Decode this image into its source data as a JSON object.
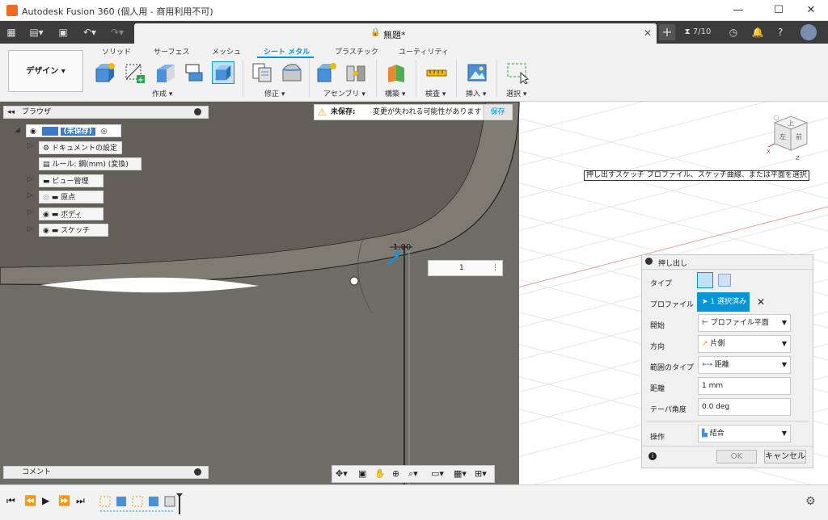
{
  "app": {
    "title": "Autodesk Fusion 360 (個人用 - 商用利用不可)"
  },
  "window_controls": {
    "minimize": "—",
    "maximize": "☐",
    "close": "✕"
  },
  "tabbar": {
    "doc_title": "無題*",
    "close": "✕",
    "new_tab": "+",
    "jobs": "7/10"
  },
  "ribbon": {
    "workspace": "デザイン ▾",
    "tabs": [
      "ソリッド",
      "サーフェス",
      "メッシュ",
      "シート メタル",
      "プラスチック",
      "ユーティリティ"
    ],
    "active_tab": "シート メタル",
    "groups": [
      "作成 ▾",
      "修正 ▾",
      "アセンブリ ▾",
      "構築 ▾",
      "検査 ▾",
      "挿入 ▾",
      "選択 ▾"
    ]
  },
  "browser": {
    "title": "ブラウザ",
    "collapse": "◂◂",
    "items": [
      {
        "label": "(未保存)"
      },
      {
        "label": "ドキュメントの設定"
      },
      {
        "label": "ルール: 鋼(mm) (変換)"
      },
      {
        "label": "ビュー管理"
      },
      {
        "label": "原点"
      },
      {
        "label": "ボディ"
      },
      {
        "label": "スケッチ"
      }
    ]
  },
  "warning": {
    "title": "未保存:",
    "message": "変更が失われる可能性があります",
    "save": "保存"
  },
  "viewcube": {
    "top": "上",
    "front": "前",
    "left": "左",
    "axis_x": "X",
    "axis_z": "Z"
  },
  "tooltip": "押し出すスケッチ プロファイル、スケッチ曲線、または平面を選択",
  "dimension_label": "1.00",
  "distance_input": {
    "value": "1"
  },
  "extrude": {
    "title": "押し出し",
    "rows": [
      {
        "label": "タイプ"
      },
      {
        "label": "プロファイル",
        "value": "1 選択済み"
      },
      {
        "label": "開始",
        "value": "プロファイル平面"
      },
      {
        "label": "方向",
        "value": "片側"
      },
      {
        "label": "範囲のタイプ",
        "value": "距離"
      },
      {
        "label": "距離",
        "value": "1 mm"
      },
      {
        "label": "テーパ角度",
        "value": "0.0 deg"
      },
      {
        "label": "操作",
        "value": "結合"
      }
    ],
    "ok": "OK",
    "cancel": "キャンセル"
  },
  "comment": {
    "title": "コメント"
  },
  "colors": {
    "accent": "#0696d7",
    "model": "#6e6d66",
    "tab_dark": "#3c3c3c",
    "warning": "#f5a623"
  }
}
